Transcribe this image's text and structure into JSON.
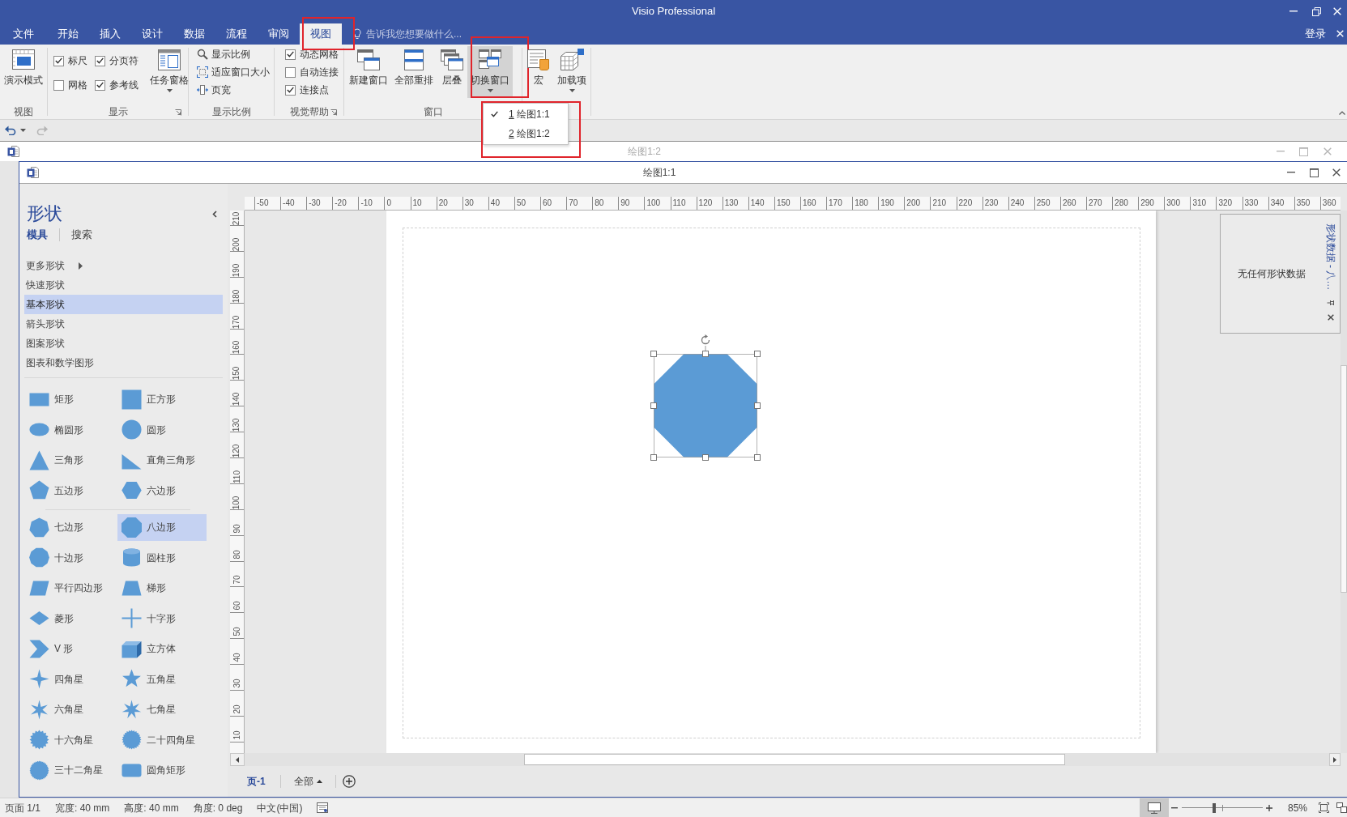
{
  "window": {
    "title": "Visio Professional",
    "sign_in": "登录"
  },
  "tabs": [
    {
      "label": "文件",
      "selected": false,
      "highlighted": false
    },
    {
      "label": "开始",
      "selected": false,
      "highlighted": false
    },
    {
      "label": "插入",
      "selected": false,
      "highlighted": false
    },
    {
      "label": "设计",
      "selected": false,
      "highlighted": false
    },
    {
      "label": "数据",
      "selected": false,
      "highlighted": false
    },
    {
      "label": "流程",
      "selected": false,
      "highlighted": false
    },
    {
      "label": "审阅",
      "selected": false,
      "highlighted": false
    },
    {
      "label": "视图",
      "selected": true,
      "highlighted": true
    }
  ],
  "tell_me": {
    "placeholder": "告诉我您想要做什么..."
  },
  "ribbon": {
    "groups": [
      {
        "label": "视图",
        "launcher": false,
        "buttons": [
          {
            "kind": "large",
            "label": "演示模式",
            "dropdown": false,
            "pressed": false,
            "highlighted": false
          }
        ]
      },
      {
        "label": "显示",
        "launcher": true,
        "checkboxes": [
          {
            "label": "标尺",
            "checked": true
          },
          {
            "label": "分页符",
            "checked": true
          },
          {
            "label": "网格",
            "checked": false
          },
          {
            "label": "参考线",
            "checked": true
          }
        ],
        "buttons": [
          {
            "kind": "large",
            "label": "任务窗格",
            "dropdown": true,
            "pressed": false,
            "highlighted": false
          }
        ]
      },
      {
        "label": "显示比例",
        "launcher": false,
        "buttons": [
          {
            "kind": "small",
            "label": "显示比例"
          },
          {
            "kind": "small",
            "label": "适应窗口大小"
          },
          {
            "kind": "small",
            "label": "页宽"
          }
        ]
      },
      {
        "label": "视觉帮助",
        "launcher": true,
        "checkboxes": [
          {
            "label": "动态网格",
            "checked": true
          },
          {
            "label": "自动连接",
            "checked": false
          },
          {
            "label": "连接点",
            "checked": true
          }
        ]
      },
      {
        "label": "窗口",
        "launcher": false,
        "buttons": [
          {
            "kind": "large",
            "label": "新建窗口",
            "dropdown": false,
            "pressed": false,
            "highlighted": false
          },
          {
            "kind": "large",
            "label": "全部重排",
            "dropdown": false,
            "pressed": false,
            "highlighted": false
          },
          {
            "kind": "large",
            "label": "层叠",
            "dropdown": false,
            "pressed": false,
            "highlighted": false
          },
          {
            "kind": "large",
            "label": "切换窗口",
            "dropdown": true,
            "pressed": true,
            "highlighted": true
          }
        ]
      },
      {
        "buttons": [
          {
            "kind": "large",
            "label": "宏",
            "dropdown": false,
            "pressed": false,
            "highlighted": false
          },
          {
            "kind": "large",
            "label": "加载项",
            "dropdown": true,
            "pressed": false,
            "highlighted": false
          }
        ]
      }
    ]
  },
  "window_menu": {
    "highlighted": true,
    "items": [
      {
        "accelerator": "1",
        "label": "绘图1:1",
        "checked": true
      },
      {
        "accelerator": "2",
        "label": "绘图1:2",
        "checked": false
      }
    ]
  },
  "quick_access": [
    {
      "kind": "undo",
      "disabled": false,
      "dropdown": true
    },
    {
      "kind": "redo",
      "disabled": true,
      "dropdown": false
    }
  ],
  "windows": [
    {
      "title": "绘图1:2",
      "active": false
    },
    {
      "title": "绘图1:1",
      "active": true
    }
  ],
  "shapes_panel": {
    "title": "形状",
    "tabs": [
      {
        "label": "模具",
        "selected": true
      },
      {
        "label": "搜索",
        "selected": false
      }
    ],
    "stencils": [
      {
        "label": "更多形状",
        "submenu": true,
        "selected": false
      },
      {
        "label": "快速形状",
        "submenu": false,
        "selected": false
      },
      {
        "label": "基本形状",
        "submenu": false,
        "selected": true
      },
      {
        "label": "箭头形状",
        "submenu": false,
        "selected": false
      },
      {
        "label": "图案形状",
        "submenu": false,
        "selected": false
      },
      {
        "label": "图表和数学图形",
        "submenu": false,
        "selected": false
      }
    ],
    "sections": [
      {
        "shapes": [
          {
            "kind": "rectangle",
            "label": "矩形",
            "selected": false
          },
          {
            "kind": "square",
            "label": "正方形",
            "selected": false
          },
          {
            "kind": "ellipse",
            "label": "椭圆形",
            "selected": false
          },
          {
            "kind": "circle",
            "label": "圆形",
            "selected": false
          },
          {
            "kind": "triangle",
            "label": "三角形",
            "selected": false
          },
          {
            "kind": "right-triangle",
            "label": "直角三角形",
            "selected": false
          },
          {
            "kind": "pentagon",
            "label": "五边形",
            "selected": false
          },
          {
            "kind": "hexagon",
            "label": "六边形",
            "selected": false
          }
        ]
      },
      {
        "shapes": [
          {
            "kind": "heptagon",
            "label": "七边形",
            "selected": false
          },
          {
            "kind": "octagon",
            "label": "八边形",
            "selected": true
          },
          {
            "kind": "decagon",
            "label": "十边形",
            "selected": false
          },
          {
            "kind": "cylinder",
            "label": "圆柱形",
            "selected": false
          },
          {
            "kind": "parallelogram",
            "label": "平行四边形",
            "selected": false
          },
          {
            "kind": "trapezoid",
            "label": "梯形",
            "selected": false
          },
          {
            "kind": "diamond",
            "label": "菱形",
            "selected": false
          },
          {
            "kind": "cross",
            "label": "十字形",
            "selected": false
          },
          {
            "kind": "chevron",
            "label": "V 形",
            "selected": false
          },
          {
            "kind": "cube",
            "label": "立方体",
            "selected": false
          },
          {
            "kind": "star4",
            "label": "四角星",
            "selected": false
          },
          {
            "kind": "star5",
            "label": "五角星",
            "selected": false
          },
          {
            "kind": "star6",
            "label": "六角星",
            "selected": false
          },
          {
            "kind": "star7",
            "label": "七角星",
            "selected": false
          },
          {
            "kind": "star16",
            "label": "十六角星",
            "selected": false
          },
          {
            "kind": "star24",
            "label": "二十四角星",
            "selected": false
          },
          {
            "kind": "star32",
            "label": "三十二角星",
            "selected": false
          },
          {
            "kind": "rounded-rectangle",
            "label": "圆角矩形",
            "selected": false
          }
        ]
      }
    ]
  },
  "rulers": {
    "horizontal": [
      "-50",
      "-40",
      "-30",
      "-20",
      "-10",
      "0",
      "10",
      "20",
      "30",
      "40",
      "50",
      "60",
      "70",
      "80",
      "90",
      "100",
      "110",
      "120",
      "130",
      "140",
      "150",
      "160",
      "170",
      "180",
      "190",
      "200",
      "210",
      "220",
      "230",
      "240",
      "250",
      "260",
      "270",
      "280",
      "290",
      "300",
      "310",
      "320",
      "330",
      "340",
      "350",
      "360"
    ],
    "vertical": [
      "210",
      "200",
      "190",
      "180",
      "170",
      "160",
      "150",
      "140",
      "130",
      "120",
      "110",
      "100",
      "90",
      "80",
      "70",
      "60",
      "50",
      "40",
      "30",
      "20",
      "10"
    ]
  },
  "drawing": {
    "shapes": [
      {
        "kind": "octagon",
        "selected": true
      }
    ]
  },
  "shape_data": {
    "title": "形状数据 - 八…",
    "message": "无任何形状数据"
  },
  "page_tabs": {
    "pages": [
      {
        "label": "页-1",
        "selected": true
      }
    ],
    "all_pages": "全部"
  },
  "status_bar": {
    "items": [
      "页面 1/1",
      "宽度: 40 mm",
      "高度: 40 mm",
      "角度: 0 deg",
      "中文(中国)"
    ],
    "zoom": {
      "level": 0.4,
      "reading": "85%"
    }
  }
}
